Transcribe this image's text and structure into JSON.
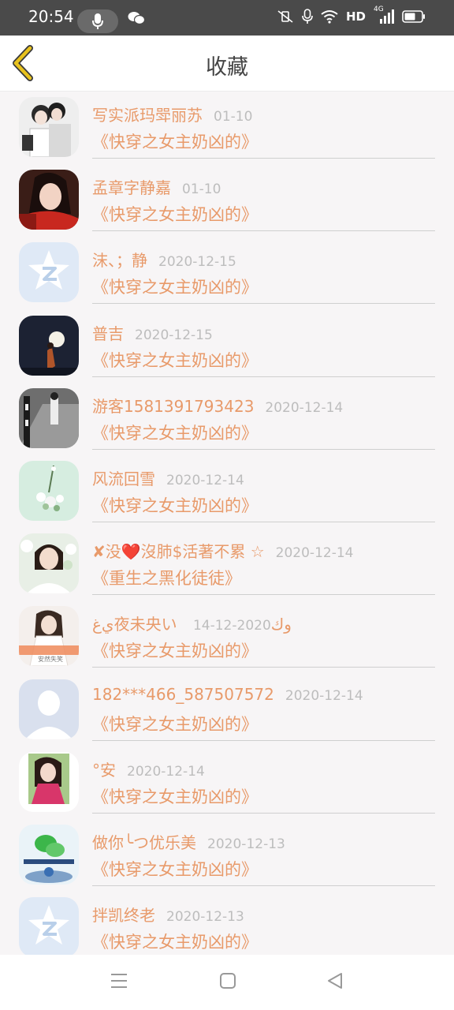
{
  "status_bar": {
    "time": "20:54",
    "network_label": "HD",
    "cellular_label": "4G"
  },
  "header": {
    "title": "收藏",
    "back_icon": "chevron-left-icon",
    "accent_color": "#e8c21e"
  },
  "items": [
    {
      "user": "写实派玛斝丽苏",
      "date": "01-10",
      "book": "《快穿之女主奶凶的》",
      "avatar": "couple-photo"
    },
    {
      "user": "孟章字静嘉",
      "date": "01-10",
      "book": "《快穿之女主奶凶的》",
      "avatar": "girl-red-photo"
    },
    {
      "user": "沫、；静",
      "date": "2020-12-15",
      "book": "《快穿之女主奶凶的》",
      "avatar": "qq-default"
    },
    {
      "user": "普吉",
      "date": "2020-12-15",
      "book": "《快穿之女主奶凶的》",
      "avatar": "moon-night-photo"
    },
    {
      "user": "游客1581391793423",
      "date": "2020-12-14",
      "book": "《快穿之女主奶凶的》",
      "avatar": "street-bw-photo"
    },
    {
      "user": "风流回雪",
      "date": "2020-12-14",
      "book": "《快穿之女主奶凶的》",
      "avatar": "flowers-photo"
    },
    {
      "user": "✘没❤️沒肺$活著不累 ☆",
      "date": "2020-12-14",
      "book": "《重生之黑化徒徒》",
      "avatar": "woman-flowers-photo"
    },
    {
      "user": "يﻍ夜未央い ﻭﻙ",
      "date": "2020-12-14",
      "book": "《快穿之女主奶凶的》",
      "avatar": "girl-banner-photo"
    },
    {
      "user": "182***466_587507572",
      "date": "2020-12-14",
      "book": "《快穿之女主奶凶的》",
      "avatar": "default-person"
    },
    {
      "user": "°安",
      "date": "2020-12-14",
      "book": "《快穿之女主奶凶的》",
      "avatar": "girl-pink-photo"
    },
    {
      "user": "做你╰つ优乐美",
      "date": "2020-12-13",
      "book": "《快穿之女主奶凶的》",
      "avatar": "wechat-default"
    },
    {
      "user": "拌凯终老",
      "date": "2020-12-13",
      "book": "《快穿之女主奶凶的》",
      "avatar": "qq-default"
    }
  ],
  "avatar_banner_text": "安然失笑",
  "nav": {
    "menu_icon": "menu-icon",
    "home_icon": "home-square-icon",
    "back_icon": "back-triangle-icon"
  },
  "colors": {
    "name_color": "#e89a6a",
    "date_color": "#bdbdbd",
    "status_bar": "#4a4a4a"
  }
}
